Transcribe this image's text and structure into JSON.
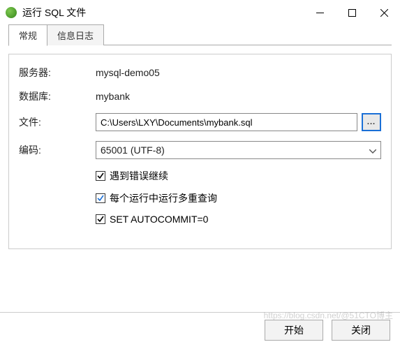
{
  "window": {
    "title": "运行 SQL 文件",
    "controls": {
      "min": "minimize",
      "max": "maximize",
      "close": "close"
    }
  },
  "tabs": {
    "general": "常规",
    "log": "信息日志"
  },
  "labels": {
    "server": "服务器:",
    "database": "数据库:",
    "file": "文件:",
    "encoding": "编码:"
  },
  "values": {
    "server": "mysql-demo05",
    "database": "mybank",
    "file": "C:\\Users\\LXY\\Documents\\mybank.sql",
    "encoding": "65001 (UTF-8)",
    "browse": "..."
  },
  "checkboxes": {
    "continue_on_error": {
      "label": "遇到错误继续",
      "checked": true
    },
    "multi_query": {
      "label": "每个运行中运行多重查询",
      "checked": true
    },
    "autocommit": {
      "label": "SET AUTOCOMMIT=0",
      "checked": true
    }
  },
  "buttons": {
    "start": "开始",
    "close": "关闭"
  },
  "watermark": "https://blog.csdn.net/@51CTO博主"
}
